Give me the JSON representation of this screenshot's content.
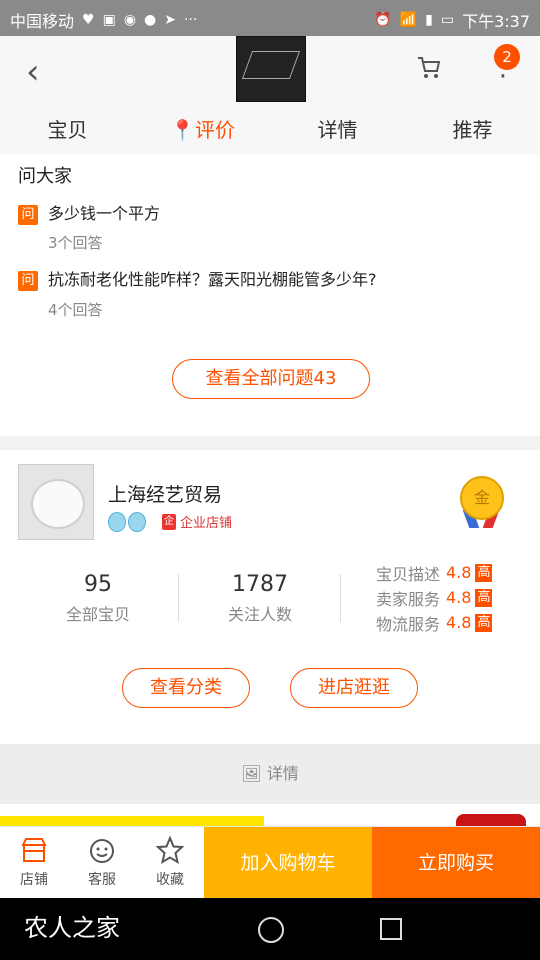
{
  "status_bar": {
    "carrier": "中国移动",
    "icons": [
      "heart-rate-icon",
      "app-icon",
      "maps-icon",
      "chat-icon",
      "telegram-icon",
      "more-dots"
    ],
    "right_icons": [
      "alarm-icon",
      "wifi-icon",
      "signal-4g-icon",
      "battery-icon"
    ],
    "time": "下午3:37"
  },
  "header": {
    "back_icon": "back-chevron-icon",
    "cart_icon": "cart-icon",
    "more_icon": "more-vertical-icon",
    "badge_count": "2"
  },
  "tabs": [
    {
      "label": "宝贝"
    },
    {
      "label": "评价",
      "icon": "location-pin-icon"
    },
    {
      "label": "详情"
    },
    {
      "label": "推荐"
    }
  ],
  "ask": {
    "title": "问大家",
    "badge": "问",
    "questions": [
      {
        "text": "多少钱一个平方",
        "answers": "3个回答"
      },
      {
        "text": "抗冻耐老化性能咋样？露天阳光棚能管多少年?",
        "answers": "4个回答"
      }
    ],
    "view_all": "查看全部问题43"
  },
  "shop": {
    "name": "上海经艺贸易",
    "enterprise_label": "企业店铺",
    "medal_text": "金",
    "stats": [
      {
        "num": "95",
        "label": "全部宝贝"
      },
      {
        "num": "1787",
        "label": "关注人数"
      }
    ],
    "ratings": [
      {
        "label": "宝贝描述",
        "score": "4.8",
        "level": "高"
      },
      {
        "label": "卖家服务",
        "score": "4.8",
        "level": "高"
      },
      {
        "label": "物流服务",
        "score": "4.8",
        "level": "高"
      }
    ],
    "btn_category": "查看分类",
    "btn_enter": "进店逛逛"
  },
  "detail_bar": {
    "icon": "image-icon",
    "label": "详情"
  },
  "bottom_bar": {
    "items": [
      {
        "label": "店铺",
        "icon": "shop-icon"
      },
      {
        "label": "客服",
        "icon": "service-icon"
      },
      {
        "label": "收藏",
        "icon": "star-icon"
      }
    ],
    "add_cart": "加入购物车",
    "buy_now": "立即购买"
  },
  "watermark": "农人之家",
  "colors": {
    "accent": "#ff5000",
    "add_cart_bg": "#ffb300",
    "buy_now_bg": "#ff6a00"
  }
}
